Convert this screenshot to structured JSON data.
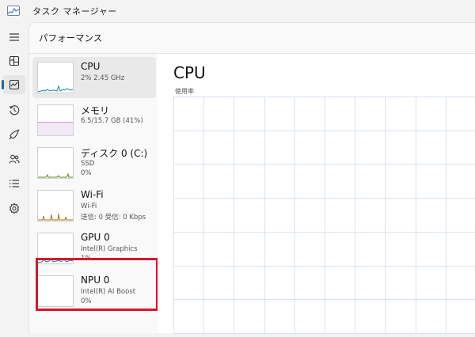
{
  "app": {
    "title": "タスク マネージャー"
  },
  "nav": {
    "items": [
      {
        "icon": "hamburger-menu-icon"
      },
      {
        "icon": "processes-icon"
      },
      {
        "icon": "performance-icon",
        "active": true
      },
      {
        "icon": "app-history-icon"
      },
      {
        "icon": "startup-apps-icon"
      },
      {
        "icon": "users-icon"
      },
      {
        "icon": "details-icon"
      },
      {
        "icon": "services-icon"
      }
    ]
  },
  "page": {
    "title": "パフォーマンス"
  },
  "devices": [
    {
      "name": "CPU",
      "sub1": "2% 2.45 GHz",
      "sub2": "",
      "selected": true,
      "graph_color": "#1b7fb8"
    },
    {
      "name": "メモリ",
      "sub1": "6.5/15.7 GB (41%)",
      "sub2": "",
      "graph_color": "#8a3e9e",
      "usage_fraction": 0.41
    },
    {
      "name": "ディスク 0 (C:)",
      "sub1": "SSD",
      "sub2": "0%",
      "graph_color": "#5e8c1d"
    },
    {
      "name": "Wi-Fi",
      "sub1": "Wi-Fi",
      "sub2": "送信: 0 受信: 0 Kbps",
      "graph_color": "#a8731b"
    },
    {
      "name": "GPU 0",
      "sub1": "Intel(R) Graphics",
      "sub2": "1%",
      "graph_color": "#1b7fb8"
    },
    {
      "name": "NPU 0",
      "sub1": "Intel(R) AI Boost",
      "sub2": "0%",
      "highlighted": true,
      "graph_color": "#1b7fb8"
    }
  ],
  "detail": {
    "title": "CPU",
    "graph_label": "使用率",
    "grid_color": "#d8e2ee"
  },
  "colors": {
    "highlight_border": "#d4172a",
    "active_indicator": "#1a6aa8"
  }
}
